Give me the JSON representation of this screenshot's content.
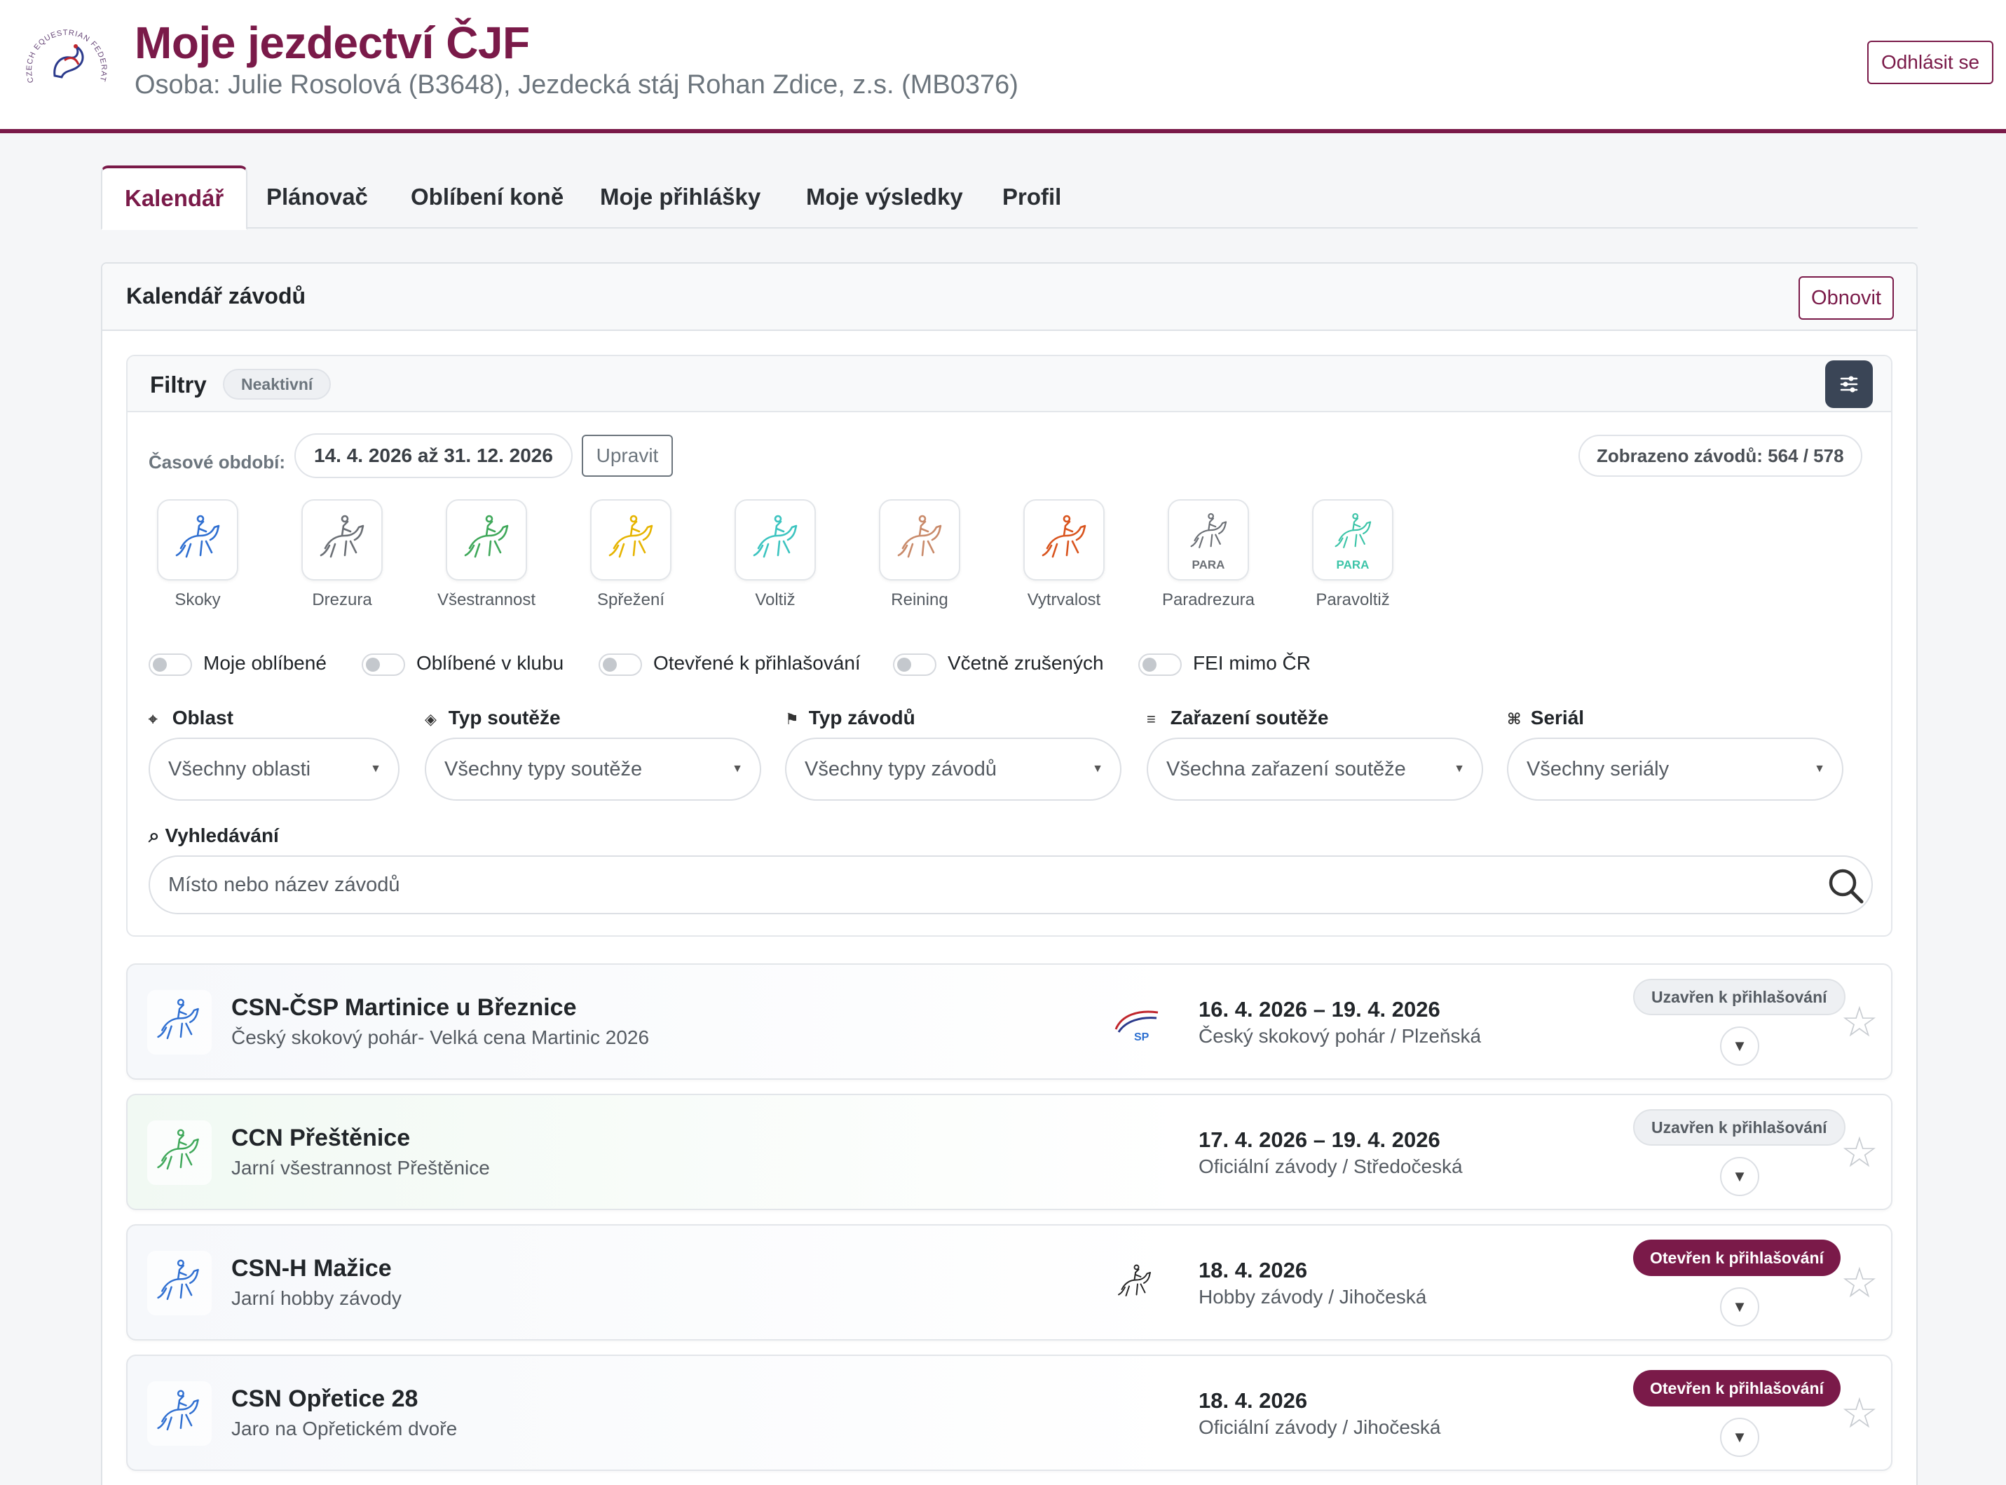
{
  "header": {
    "title": "Moje jezdectví ČJF",
    "subtitle": "Osoba: Julie Rosolová (B3648), Jezdecká stáj Rohan Zdice, z.s. (MB0376)",
    "logout_label": "Odhlásit se",
    "logo_text": "CZECH EQUESTRIAN FEDERATION"
  },
  "tabs": [
    {
      "label": "Kalendář",
      "active": true
    },
    {
      "label": "Plánovač"
    },
    {
      "label": "Oblíbení koně"
    },
    {
      "label": "Moje přihlášky"
    },
    {
      "label": "Moje výsledky"
    },
    {
      "label": "Profil"
    }
  ],
  "calendar": {
    "title": "Kalendář závodů",
    "refresh_label": "Obnovit"
  },
  "filters": {
    "title": "Filtry",
    "status_badge": "Neaktivní",
    "period_label": "Časové období:",
    "period_value": "14. 4. 2026 až 31. 12. 2026",
    "edit_label": "Upravit",
    "count_label": "Zobrazeno závodů: 564 / 578",
    "disciplines": [
      {
        "label": "Skoky",
        "color": "#2f6fd1"
      },
      {
        "label": "Drezura",
        "color": "#6b6f75"
      },
      {
        "label": "Všestrannost",
        "color": "#3fa85a"
      },
      {
        "label": "Spřežení",
        "color": "#e6b400"
      },
      {
        "label": "Voltiž",
        "color": "#3cc4c0"
      },
      {
        "label": "Reining",
        "color": "#c98a6a"
      },
      {
        "label": "Vytrvalost",
        "color": "#d9541e"
      },
      {
        "label": "Paradrezura",
        "color": "#6b6f75",
        "para": "PARA"
      },
      {
        "label": "Paravoltiž",
        "color": "#3cc4a8",
        "para": "PARA"
      }
    ],
    "switches": [
      {
        "label": "Moje oblíbené"
      },
      {
        "label": "Oblíbené v klubu"
      },
      {
        "label": "Otevřené k přihlašování"
      },
      {
        "label": "Včetně zrušených"
      },
      {
        "label": "FEI mimo ČR"
      }
    ],
    "selects": [
      {
        "label": "Oblast",
        "icon": "⌖",
        "value": "Všechny oblasti"
      },
      {
        "label": "Typ soutěže",
        "icon": "◈",
        "value": "Všechny typy soutěže"
      },
      {
        "label": "Typ závodů",
        "icon": "⚑",
        "value": "Všechny typy závodů"
      },
      {
        "label": "Zařazení soutěže",
        "icon": "≡",
        "value": "Všechna zařazení soutěže"
      },
      {
        "label": "Seriál",
        "icon": "⌘",
        "value": "Všechny seriály"
      }
    ],
    "search_label": "Vyhledávání",
    "search_icon": "⌕",
    "search_placeholder": "Místo nebo název závodů"
  },
  "events": [
    {
      "title": "CSN-ČSP Martinice u Březnice",
      "subtitle": "Český skokový pohár- Velká cena Martinic 2026",
      "date": "16. 4. 2026 – 19. 4. 2026",
      "type": "Český skokový pohár / Plzeňská",
      "status": "Uzavřen k přihlašování",
      "status_kind": "closed",
      "discipline_color": "#2f6fd1",
      "logo": "SP",
      "bg": "blue"
    },
    {
      "title": "CCN Přeštěnice",
      "subtitle": "Jarní všestrannost Přeštěnice",
      "date": "17. 4. 2026 – 19. 4. 2026",
      "type": "Oficiální závody / Středočeská",
      "status": "Uzavřen k přihlašování",
      "status_kind": "closed",
      "discipline_color": "#3fa85a",
      "logo": "",
      "bg": "green"
    },
    {
      "title": "CSN-H Mažice",
      "subtitle": "Jarní hobby závody",
      "date": "18. 4. 2026",
      "type": "Hobby závody / Jihočeská",
      "status": "Otevřen k přihlašování",
      "status_kind": "open",
      "discipline_color": "#2f6fd1",
      "logo": "horse",
      "bg": "blue"
    },
    {
      "title": "CSN Opřetice 28",
      "subtitle": "Jaro na Opřetickém dvoře",
      "date": "18. 4. 2026",
      "type": "Oficiální závody / Jihočeská",
      "status": "Otevřen k přihlašování",
      "status_kind": "open",
      "discipline_color": "#2f6fd1",
      "logo": "",
      "bg": "blue"
    }
  ]
}
